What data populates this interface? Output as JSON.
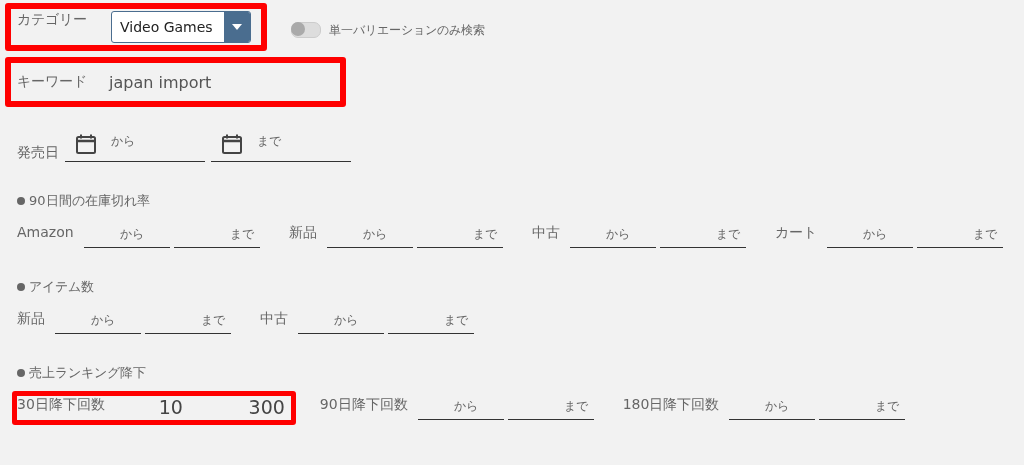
{
  "category": {
    "label": "カテゴリー",
    "value": "Video Games",
    "highlighted": true
  },
  "single_variation": {
    "label": "単一バリエーションのみ検索",
    "on": false
  },
  "keyword": {
    "label": "キーワード",
    "value": "japan import",
    "highlighted": true
  },
  "release_date": {
    "label": "発売日",
    "from": {
      "placeholder": "から"
    },
    "to": {
      "placeholder": "まで"
    }
  },
  "sections": [
    {
      "title": "90日間の在庫切れ率",
      "groups": [
        {
          "label": "Amazon",
          "highlighted": false,
          "from": {
            "placeholder": "から"
          },
          "to": {
            "placeholder": "まで"
          }
        },
        {
          "label": "新品",
          "highlighted": false,
          "from": {
            "placeholder": "から"
          },
          "to": {
            "placeholder": "まで"
          }
        },
        {
          "label": "中古",
          "highlighted": false,
          "from": {
            "placeholder": "から"
          },
          "to": {
            "placeholder": "まで"
          }
        },
        {
          "label": "カート",
          "highlighted": false,
          "from": {
            "placeholder": "から"
          },
          "to": {
            "placeholder": "まで"
          }
        }
      ]
    },
    {
      "title": "アイテム数",
      "groups": [
        {
          "label": "新品",
          "highlighted": false,
          "from": {
            "placeholder": "から"
          },
          "to": {
            "placeholder": "まで"
          }
        },
        {
          "label": "中古",
          "highlighted": false,
          "from": {
            "placeholder": "から"
          },
          "to": {
            "placeholder": "まで"
          }
        }
      ]
    },
    {
      "title": "売上ランキング降下",
      "groups": [
        {
          "label": "30日降下回数",
          "highlighted": true,
          "from": {
            "value": "10"
          },
          "to": {
            "value": "300"
          }
        },
        {
          "label": "90日降下回数",
          "highlighted": false,
          "from": {
            "placeholder": "から"
          },
          "to": {
            "placeholder": "まで"
          }
        },
        {
          "label": "180日降下回数",
          "highlighted": false,
          "from": {
            "placeholder": "から"
          },
          "to": {
            "placeholder": "まで"
          }
        }
      ]
    }
  ]
}
